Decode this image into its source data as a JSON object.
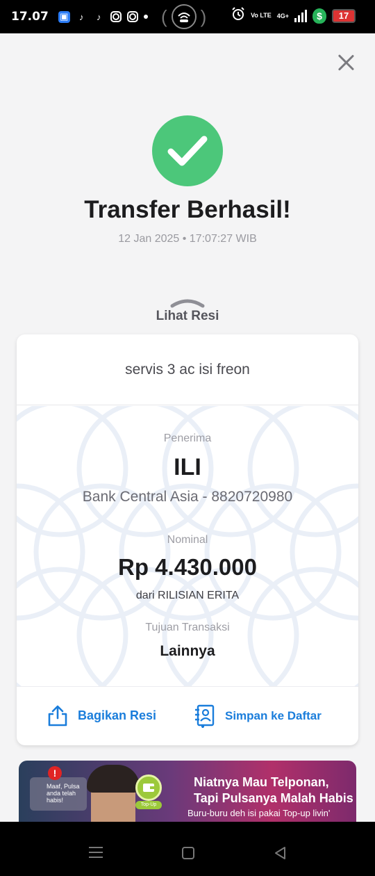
{
  "status_bar": {
    "time": "17.07",
    "battery": "17",
    "network": "4G+",
    "volte": "Vo LTE"
  },
  "success": {
    "title": "Transfer Berhasil!",
    "datetime": "12 Jan 2025 • 17:07:27 WIB",
    "view_receipt": "Lihat Resi"
  },
  "receipt": {
    "note": "servis 3 ac isi freon",
    "recipient_label": "Penerima",
    "recipient_name": "ILI",
    "recipient_bank": "Bank Central Asia - 8820720980",
    "amount_label": "Nominal",
    "amount": "Rp 4.430.000",
    "sender": "dari RILISIAN ERITA",
    "purpose_label": "Tujuan Transaksi",
    "purpose": "Lainnya",
    "share_label": "Bagikan Resi",
    "save_label": "Simpan ke Daftar"
  },
  "banner": {
    "alert_text": "Maaf, Pulsa anda telah habis!",
    "headline_1": "Niatnya Mau Telponan,",
    "headline_2": "Tapi Pulsanya Malah Habis",
    "subtext": "Buru-buru deh isi pakai Top-up livin'",
    "topup_badge": "Top-Up"
  },
  "colors": {
    "accent": "#1a7ddb",
    "success": "#4cc77a",
    "background": "#f4f4f5"
  },
  "icons": [
    "close-icon",
    "check-icon",
    "chevron-up-icon",
    "share-icon",
    "save-contact-icon"
  ]
}
